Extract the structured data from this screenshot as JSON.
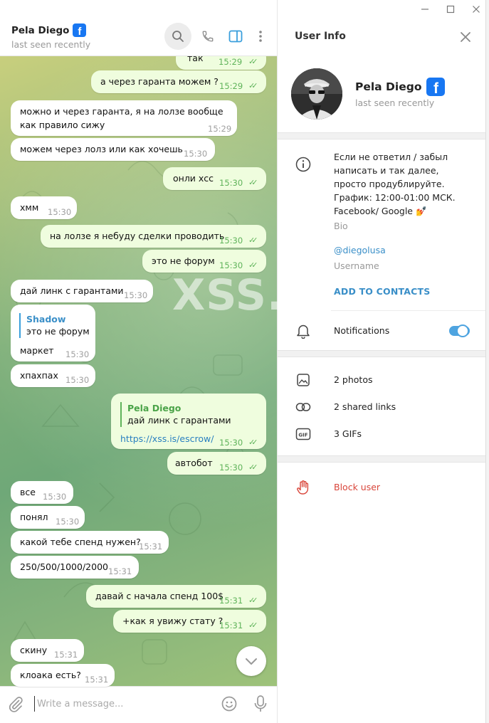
{
  "window": {
    "controls": [
      "minimize-icon",
      "maximize-icon",
      "close-icon"
    ]
  },
  "chat": {
    "title": "Pela Diego",
    "status": "last seen recently",
    "watermark": "XSS.is",
    "composer_placeholder": "Write a message...",
    "messages": [
      {
        "dir": "out",
        "text": "так",
        "time": "15:29",
        "read": true
      },
      {
        "dir": "out",
        "text": "а через гаранта можем ?",
        "time": "15:29",
        "read": true
      },
      {
        "dir": "in",
        "text": "можно и через гаранта, я на лолзе вообще как правило сижу",
        "time": "15:29"
      },
      {
        "dir": "in",
        "text": "можем через лолз или как хочешь",
        "time": "15:30"
      },
      {
        "dir": "out",
        "text": "онли хсс",
        "time": "15:30",
        "read": true
      },
      {
        "dir": "in",
        "text": "хмм",
        "time": "15:30"
      },
      {
        "dir": "out",
        "text": "на лолзе я небуду сделки проводить",
        "time": "15:30",
        "read": true
      },
      {
        "dir": "out",
        "text": "это не форум",
        "time": "15:30",
        "read": true
      },
      {
        "dir": "in",
        "text": "дай линк с гарантами",
        "time": "15:30"
      },
      {
        "dir": "in",
        "reply_name": "Shadow",
        "reply_text": "это не форум",
        "text": "маркет",
        "time": "15:30"
      },
      {
        "dir": "in",
        "text": "хпахпах",
        "time": "15:30"
      },
      {
        "dir": "out",
        "reply_name": "Pela Diego",
        "reply_text": "дай линк с гарантами",
        "text": "https://xss.is/escrow/",
        "time": "15:30",
        "read": true
      },
      {
        "dir": "out",
        "text": "автобот",
        "time": "15:30",
        "read": true
      },
      {
        "dir": "in",
        "text": "все",
        "time": "15:30"
      },
      {
        "dir": "in",
        "text": "понял",
        "time": "15:30"
      },
      {
        "dir": "in",
        "text": "какой тебе спенд нужен?",
        "time": "15:31"
      },
      {
        "dir": "in",
        "text": "250/500/1000/2000",
        "time": "15:31"
      },
      {
        "dir": "out",
        "text": "давай с начала спенд 100$",
        "time": "15:31",
        "read": true
      },
      {
        "dir": "out",
        "text": "+как я увижу стату ?",
        "time": "15:31",
        "read": true
      },
      {
        "dir": "in",
        "text": "скину",
        "time": "15:31"
      },
      {
        "dir": "in",
        "text": "клоака есть?",
        "time": "15:31"
      }
    ]
  },
  "info": {
    "header": "User Info",
    "name": "Pela Diego",
    "status": "last seen recently",
    "bio": "Если не ответил / забыл написать и так далее, просто продублируйте. График: 12:00-01:00 МСК. Facebook/ Google 💅",
    "bio_label": "Bio",
    "username": "@diegolusa",
    "username_label": "Username",
    "add_contact": "ADD TO CONTACTS",
    "notifications_label": "Notifications",
    "notifications_on": true,
    "media": [
      {
        "icon": "photo-icon",
        "label": "2 photos"
      },
      {
        "icon": "link-icon",
        "label": "2 shared links"
      },
      {
        "icon": "gif-icon",
        "label": "3 GIFs"
      }
    ],
    "block": "Block user"
  },
  "colors": {
    "accent": "#3a8fc8",
    "outgoing_bubble": "#effdde",
    "incoming_bubble": "#ffffff",
    "read_check": "#5fb35a",
    "danger": "#d9453a",
    "facebook": "#1877f2"
  }
}
